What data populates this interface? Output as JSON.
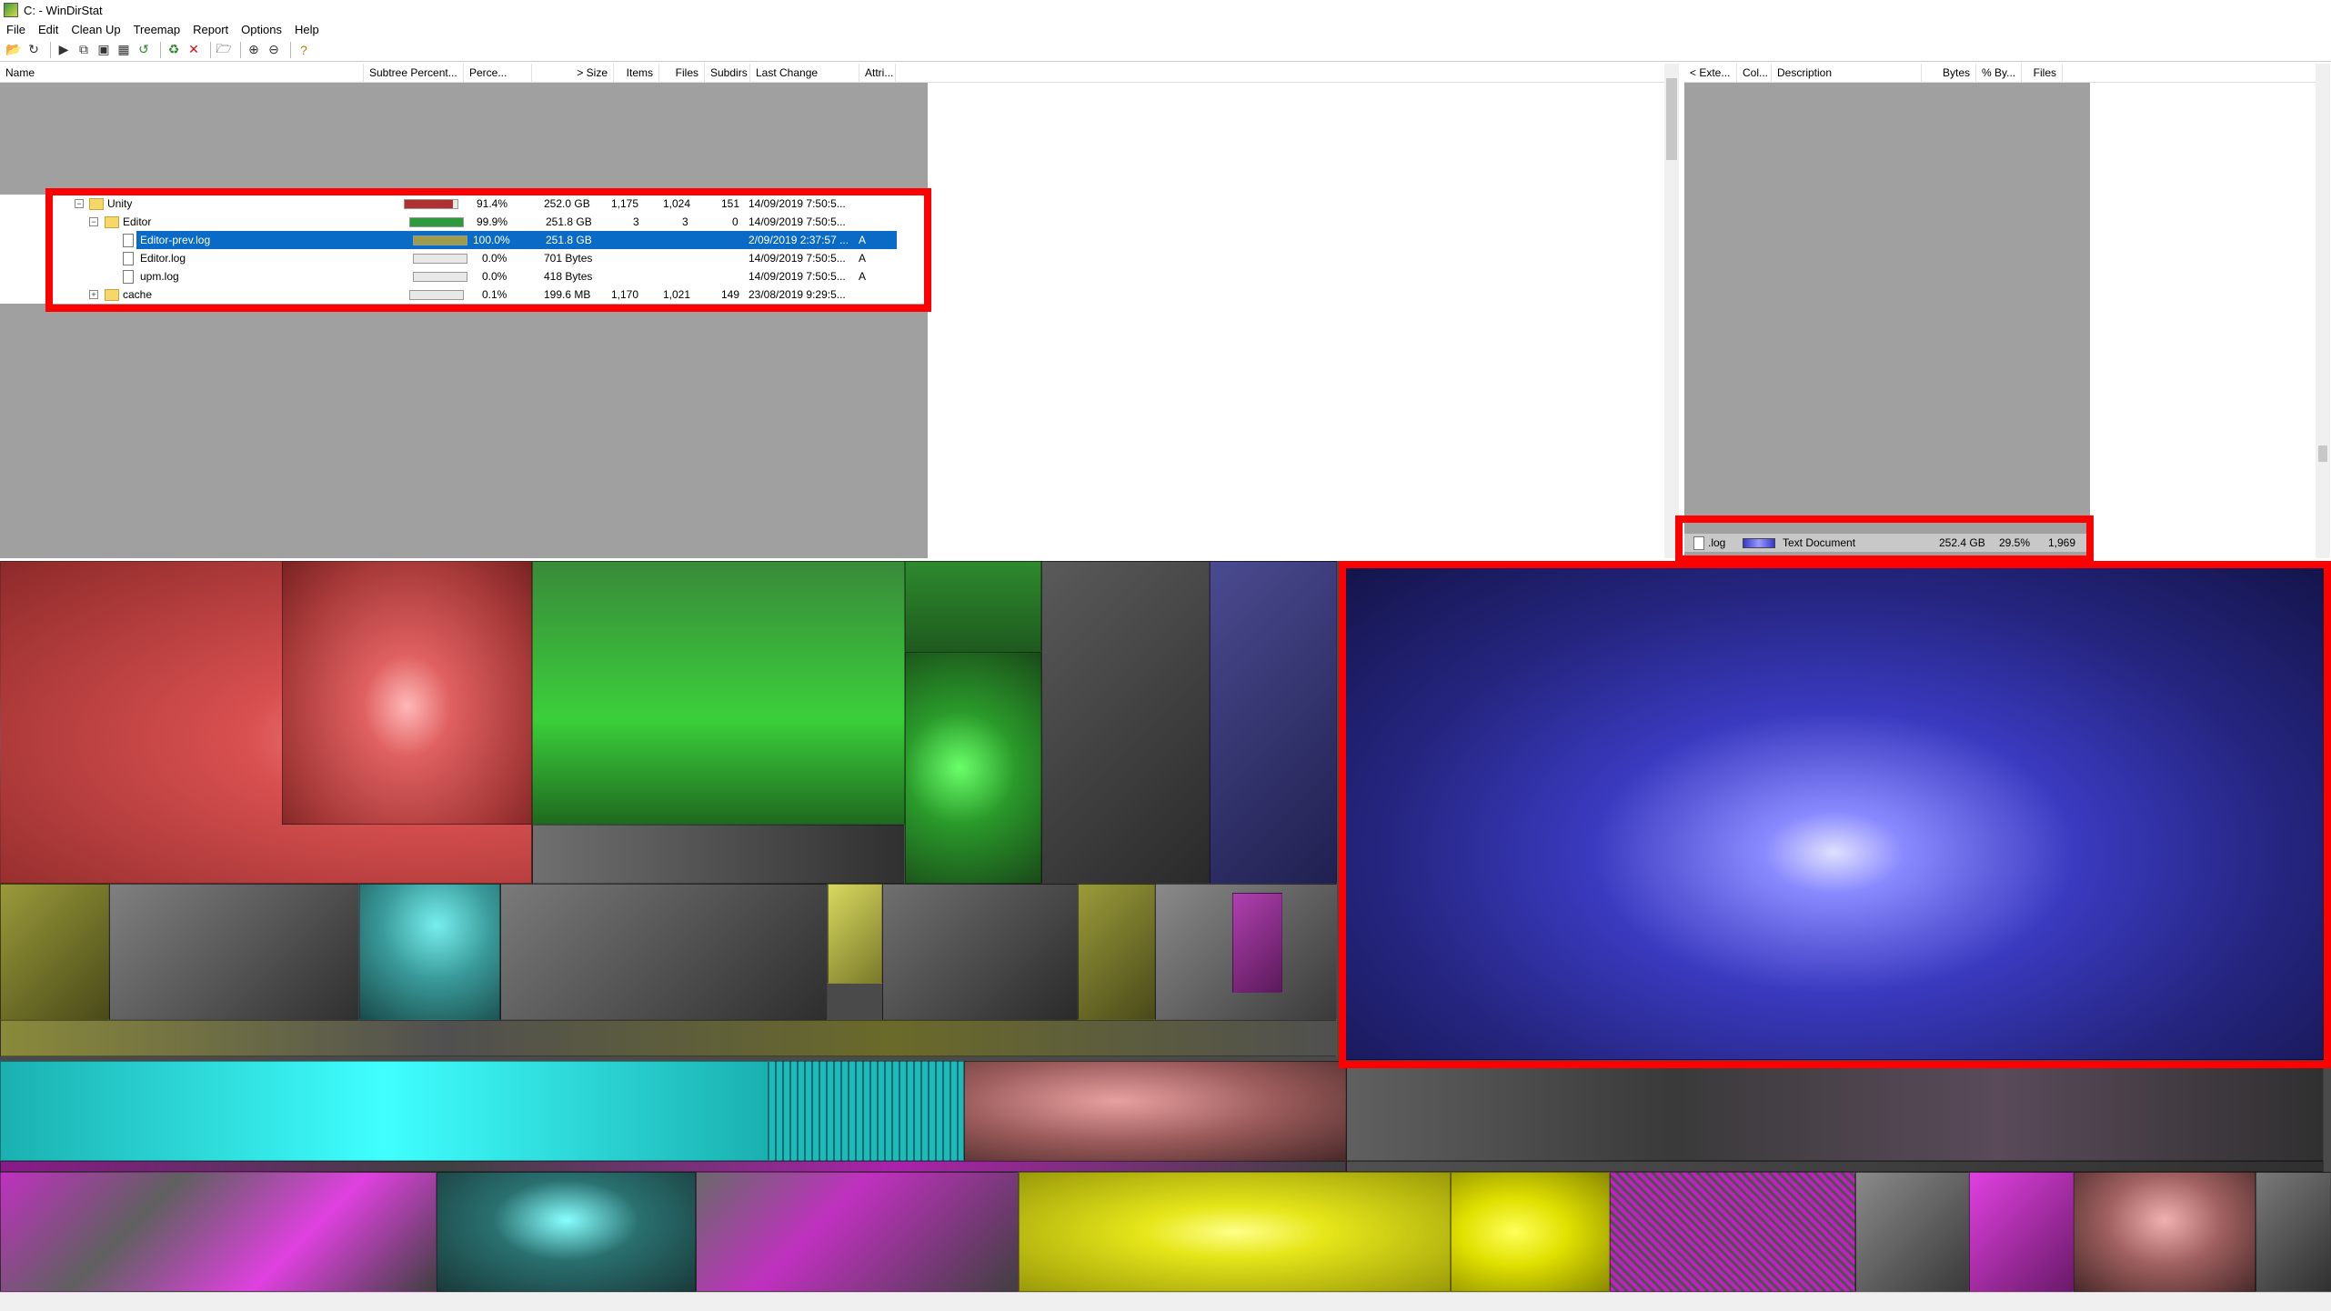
{
  "window": {
    "title": "C: - WinDirStat"
  },
  "menu": [
    "File",
    "Edit",
    "Clean Up",
    "Treemap",
    "Report",
    "Options",
    "Help"
  ],
  "toolbar_icons": [
    "open-icon",
    "refresh-icon",
    "play-icon",
    "copy-icon",
    "explorer-icon",
    "cmd-icon",
    "refresh-all-icon",
    "recycle-icon",
    "delete-icon",
    "new-folder-icon",
    "zoom-in-icon",
    "zoom-out-icon",
    "help-icon"
  ],
  "directory_list": {
    "columns": [
      "Name",
      "Subtree Percent...",
      "Perce...",
      "> Size",
      "Items",
      "Files",
      "Subdirs",
      "Last Change",
      "Attri..."
    ],
    "rows": [
      {
        "expander": "−",
        "icon": "folder-icon",
        "name": "Unity",
        "bar_percent": 91.4,
        "bar_color": "#b03030",
        "percent": "91.4%",
        "size": "252.0 GB",
        "items": "1,175",
        "files": "1,024",
        "subdirs": "151",
        "last_change": "14/09/2019  7:50:5...",
        "attr": ""
      },
      {
        "expander": "−",
        "icon": "folder-icon",
        "name": "Editor",
        "bar_percent": 99.9,
        "bar_color": "#2e9a3e",
        "percent": "99.9%",
        "size": "251.8 GB",
        "items": "3",
        "files": "3",
        "subdirs": "0",
        "last_change": "14/09/2019  7:50:5...",
        "attr": ""
      },
      {
        "expander": "",
        "icon": "file-icon",
        "name": "Editor-prev.log",
        "bar_percent": 100.0,
        "bar_color": "#9c9c4a",
        "percent": "100.0%",
        "size": "251.8 GB",
        "items": "",
        "files": "",
        "subdirs": "",
        "last_change": "2/09/2019  2:37:57 ...",
        "attr": "A"
      },
      {
        "expander": "",
        "icon": "file-icon",
        "name": "Editor.log",
        "bar_percent": 0.0,
        "bar_color": "#bbbbbb",
        "percent": "0.0%",
        "size": "701 Bytes",
        "items": "",
        "files": "",
        "subdirs": "",
        "last_change": "14/09/2019  7:50:5...",
        "attr": "A"
      },
      {
        "expander": "",
        "icon": "file-icon",
        "name": "upm.log",
        "bar_percent": 0.0,
        "bar_color": "#bbbbbb",
        "percent": "0.0%",
        "size": "418 Bytes",
        "items": "",
        "files": "",
        "subdirs": "",
        "last_change": "14/09/2019  7:50:5...",
        "attr": "A"
      },
      {
        "expander": "+",
        "icon": "folder-icon",
        "name": "cache",
        "bar_percent": 0.1,
        "bar_color": "#bbbbbb",
        "percent": "0.1%",
        "size": "199.6 MB",
        "items": "1,170",
        "files": "1,021",
        "subdirs": "149",
        "last_change": "23/08/2019  9:29:5...",
        "attr": ""
      }
    ]
  },
  "extension_list": {
    "columns": [
      "< Exte...",
      "Col...",
      "Description",
      "Bytes",
      "% By...",
      "Files"
    ],
    "rows": [
      {
        "extension": ".log",
        "color": "#6a6af0",
        "description": "Text Document",
        "bytes": "252.4 GB",
        "percent_bytes": "29.5%",
        "files": "1,969"
      }
    ]
  },
  "colors": {
    "highlight": "#ff0000",
    "selection": "#0a6bc6",
    "pane_grey": "#a0a0a0"
  }
}
